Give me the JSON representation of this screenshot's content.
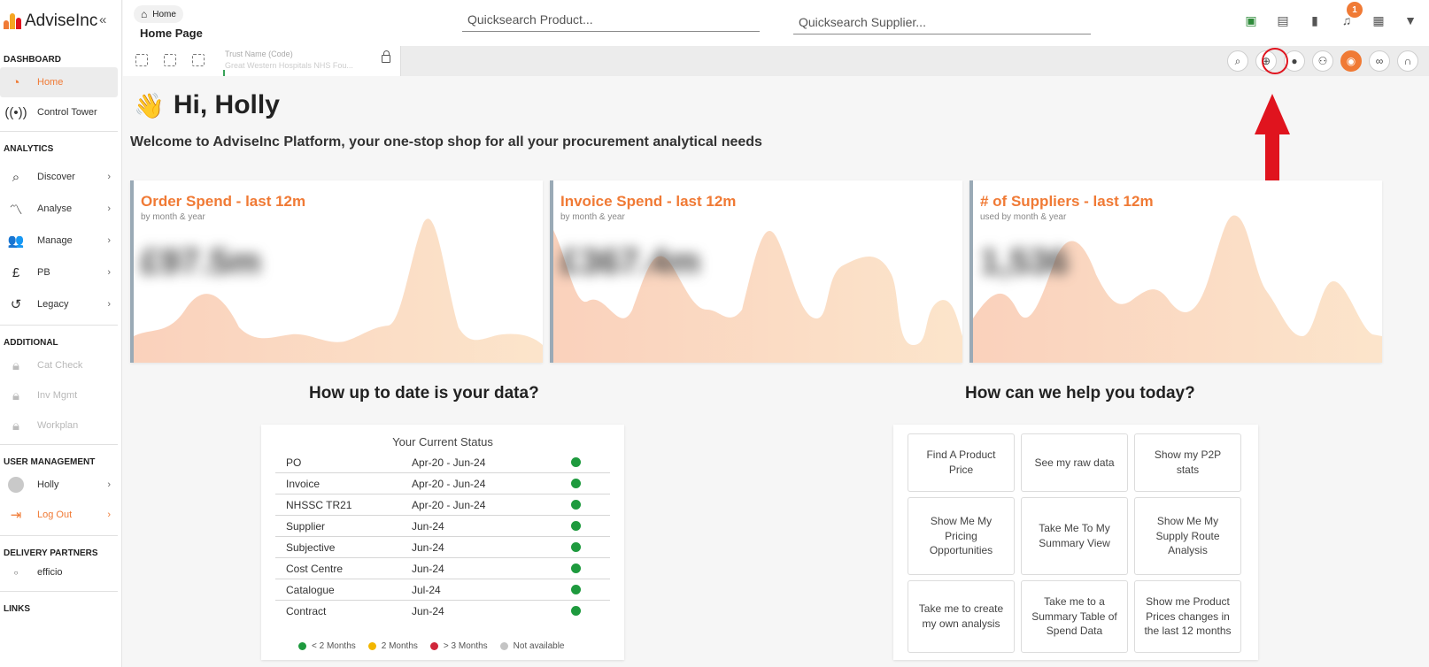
{
  "sidebar": {
    "brand": "AdviseInc",
    "collapse_glyph": "«",
    "sections": {
      "dashboard": "DASHBOARD",
      "analytics": "ANALYTICS",
      "additional": "ADDITIONAL",
      "user_management": "USER MANAGEMENT",
      "delivery_partners": "DELIVERY PARTNERS",
      "links": "LINKS"
    },
    "items": {
      "home": "Home",
      "control_tower": "Control Tower",
      "discover": "Discover",
      "analyse": "Analyse",
      "manage": "Manage",
      "pb": "PB",
      "legacy": "Legacy",
      "cat_check": "Cat Check",
      "inv_mgmt": "Inv Mgmt",
      "workplan": "Workplan",
      "holly": "Holly",
      "log_out": "Log Out",
      "efficio": "efficio"
    }
  },
  "header": {
    "breadcrumb": "Home",
    "page_title": "Home Page",
    "quicksearch_product_placeholder": "Quicksearch Product...",
    "quicksearch_supplier_placeholder": "Quicksearch Supplier...",
    "notification_count": "1"
  },
  "subbar": {
    "trust_label": "Trust Name (Code)",
    "trust_value": "Great Western Hospitals NHS Fou..."
  },
  "main": {
    "greeting": "Hi, Holly",
    "greeting_emoji": "👋",
    "welcome": "Welcome to AdviseInc Platform, your one-stop shop for all your procurement analytical needs",
    "cards": [
      {
        "title": "Order Spend - last 12m",
        "subtitle": "by month & year",
        "value": "£97.5m"
      },
      {
        "title": "Invoice Spend - last 12m",
        "subtitle": "by month & year",
        "value": "£367.4m"
      },
      {
        "title": "# of Suppliers - last 12m",
        "subtitle": "used by month & year",
        "value": "1,536"
      }
    ],
    "data_section_title": "How up to date is your data?",
    "status_title": "Your Current Status",
    "status_rows": [
      {
        "name": "PO",
        "range": "Apr-20 - Jun-24"
      },
      {
        "name": "Invoice",
        "range": "Apr-20 - Jun-24"
      },
      {
        "name": "NHSSC TR21",
        "range": "Apr-20 - Jun-24"
      },
      {
        "name": "Supplier",
        "range": "Jun-24"
      },
      {
        "name": "Subjective",
        "range": "Jun-24"
      },
      {
        "name": "Cost Centre",
        "range": "Jun-24"
      },
      {
        "name": "Catalogue",
        "range": "Jul-24"
      },
      {
        "name": "Contract",
        "range": "Jun-24"
      }
    ],
    "legend": [
      "< 2 Months",
      "2 Months",
      "> 3 Months",
      "Not available"
    ],
    "help_section_title": "How can we help you today?",
    "help_buttons": [
      "Find A Product Price",
      "See my raw data",
      "Show my P2P stats",
      "Show Me My Pricing Opportunities",
      "Take Me To My Summary View",
      "Show Me My Supply Route Analysis",
      "Take me to create my own analysis",
      "Take me to a Summary Table of Spend Data",
      "Show me Product Prices changes in the last 12 months"
    ]
  },
  "colors": {
    "accent": "#f07a35",
    "status_green": "#1e9a3e",
    "status_yellow": "#f2b600",
    "status_red": "#d0263a",
    "status_grey": "#c4c4c4",
    "annotation_red": "#e0141e"
  }
}
